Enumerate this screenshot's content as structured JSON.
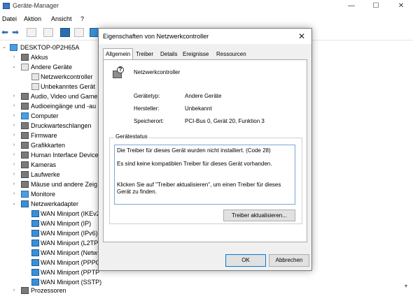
{
  "window": {
    "title": "Geräte-Manager",
    "minimize": "—",
    "maximize": "☐",
    "close": "✕"
  },
  "menu": [
    "Datei",
    "Aktion",
    "Ansicht",
    "?"
  ],
  "tree": {
    "root": "DESKTOP-0P2H65A",
    "items": [
      {
        "label": "Akkus"
      },
      {
        "label": "Andere Geräte"
      },
      {
        "label": "Netzwerkcontroller"
      },
      {
        "label": "Unbekanntes Gerät"
      },
      {
        "label": "Audio, Video und Game"
      },
      {
        "label": "Audioeingänge und -au"
      },
      {
        "label": "Computer"
      },
      {
        "label": "Druckwarteschlangen"
      },
      {
        "label": "Firmware"
      },
      {
        "label": "Grafikkarten"
      },
      {
        "label": "Human Interface Devices"
      },
      {
        "label": "Kameras"
      },
      {
        "label": "Laufwerke"
      },
      {
        "label": "Mäuse und andere Zeig"
      },
      {
        "label": "Monitore"
      },
      {
        "label": "Netzwerkadapter"
      },
      {
        "label": "WAN Miniport (IKEv2"
      },
      {
        "label": "WAN Miniport (IP)"
      },
      {
        "label": "WAN Miniport (IPv6)"
      },
      {
        "label": "WAN Miniport (L2TP"
      },
      {
        "label": "WAN Miniport (Netw"
      },
      {
        "label": "WAN Miniport (PPPO"
      },
      {
        "label": "WAN Miniport (PPTP"
      },
      {
        "label": "WAN Miniport (SSTP)"
      },
      {
        "label": "Prozessoren"
      }
    ]
  },
  "dialog": {
    "title": "Eigenschaften von Netzwerkcontroller",
    "tabs": [
      "Allgemein",
      "Treiber",
      "Details",
      "Ereignisse",
      "Ressourcen"
    ],
    "device_name": "Netzwerkcontroller",
    "fields": [
      {
        "label": "Gerätetyp:",
        "value": "Andere Geräte"
      },
      {
        "label": "Hersteller:",
        "value": "Unbekannt"
      },
      {
        "label": "Speicherort:",
        "value": "PCI-Bus 0, Gerät 20, Funktion 3"
      }
    ],
    "status_caption": "Gerätestatus",
    "status_lines": [
      "Die Treiber für dieses Gerät wurden nicht installiert. (Code 28)",
      "Es sind keine kompatiblen Treiber für dieses Gerät vorhanden.",
      "Klicken Sie auf \"Treiber aktualisieren\", um einen Treiber für dieses Gerät zu finden."
    ],
    "update_button": "Treiber aktualisieren...",
    "ok": "OK",
    "cancel": "Abbrechen"
  }
}
